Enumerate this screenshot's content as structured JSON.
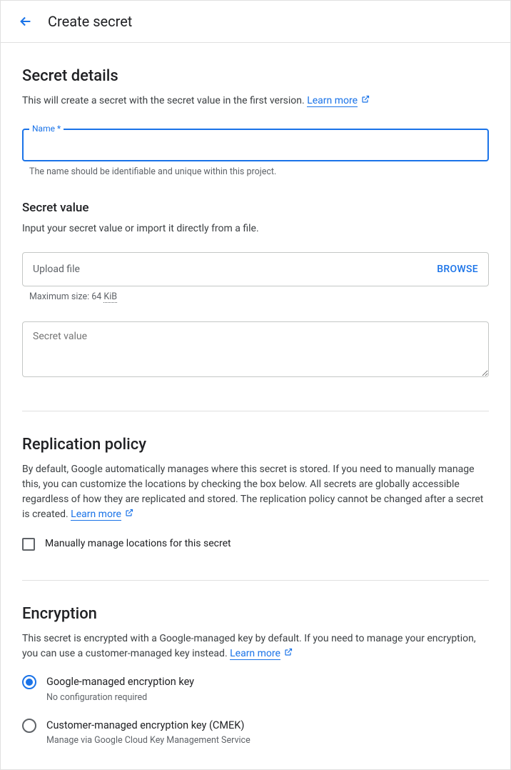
{
  "header": {
    "title": "Create secret"
  },
  "secretDetails": {
    "title": "Secret details",
    "desc": "This will create a secret with the secret value in the first version. ",
    "learnMore": "Learn more",
    "name": {
      "label": "Name *",
      "value": "",
      "helper": "The name should be identifiable and unique within this project."
    }
  },
  "secretValue": {
    "title": "Secret value",
    "desc": "Input your secret value or import it directly from a file.",
    "upload": {
      "label": "Upload file",
      "browse": "BROWSE",
      "helper_prefix": "Maximum size: 64 ",
      "helper_unit": "KiB"
    },
    "textarea": {
      "placeholder": "Secret value"
    }
  },
  "replication": {
    "title": "Replication policy",
    "desc": "By default, Google automatically manages where this secret is stored. If you need to manually manage this, you can customize the locations by checking the box below. All secrets are globally accessible regardless of how they are replicated and stored. The replication policy cannot be changed after a secret is created. ",
    "learnMore": "Learn more",
    "checkbox": "Manually manage locations for this secret"
  },
  "encryption": {
    "title": "Encryption",
    "desc": "This secret is encrypted with a Google-managed key by default. If you need to manage your encryption, you can use a customer-managed key instead. ",
    "learnMore": "Learn more",
    "options": {
      "google": {
        "label": "Google-managed encryption key",
        "sub": "No configuration required",
        "selected": true
      },
      "cmek": {
        "label": "Customer-managed encryption key (CMEK)",
        "sub": "Manage via Google Cloud Key Management Service",
        "selected": false
      }
    }
  }
}
